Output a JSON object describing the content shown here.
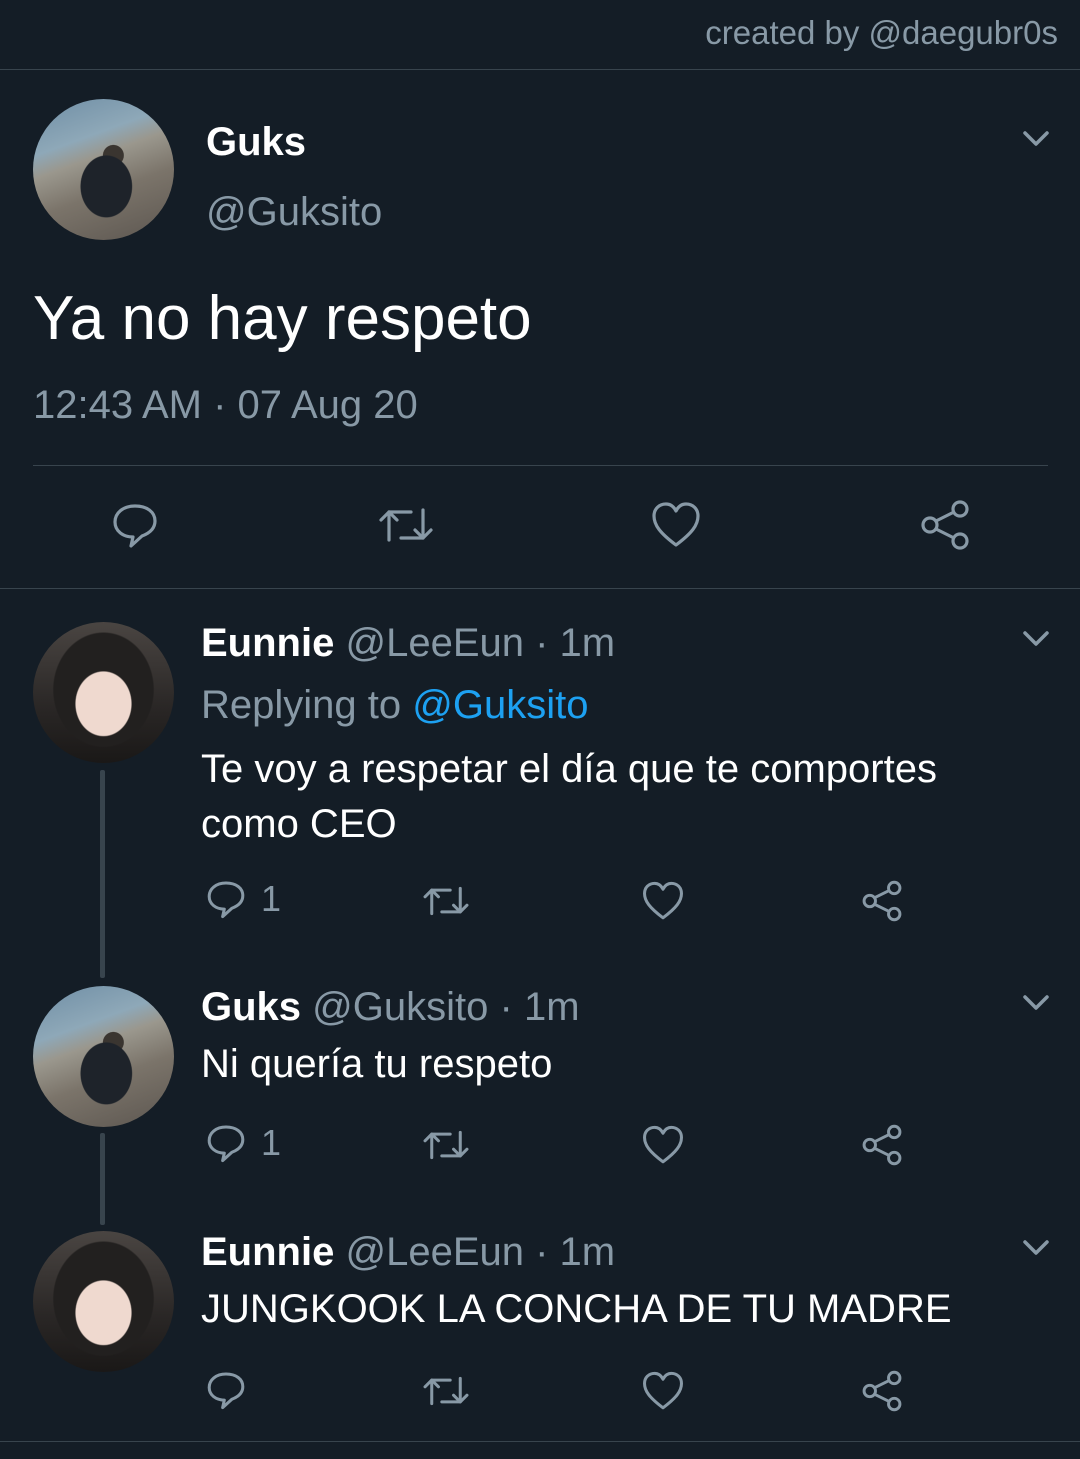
{
  "credit": "created by @daegubr0s",
  "main_tweet": {
    "name": "Guks",
    "handle": "@Guksito",
    "text": "Ya no hay respeto",
    "timestamp": "12:43 AM · 07 Aug 20"
  },
  "replies": [
    {
      "name": "Eunnie",
      "handle": "@LeeEun",
      "time": "· 1m",
      "replying_prefix": "Replying to",
      "replying_to": "@Guksito",
      "text": "Te voy a respetar el día que te comportes como CEO",
      "reply_count": "1"
    },
    {
      "name": "Guks",
      "handle": "@Guksito",
      "time": "· 1m",
      "text": "Ni quería tu respeto",
      "reply_count": "1"
    },
    {
      "name": "Eunnie",
      "handle": "@LeeEun",
      "time": "· 1m",
      "text": "JUNGKOOK LA CONCHA DE TU MADRE"
    }
  ],
  "colors": {
    "background": "#141d26",
    "text_muted": "#8899a6",
    "link": "#1da1f2",
    "divider": "#38444d"
  }
}
